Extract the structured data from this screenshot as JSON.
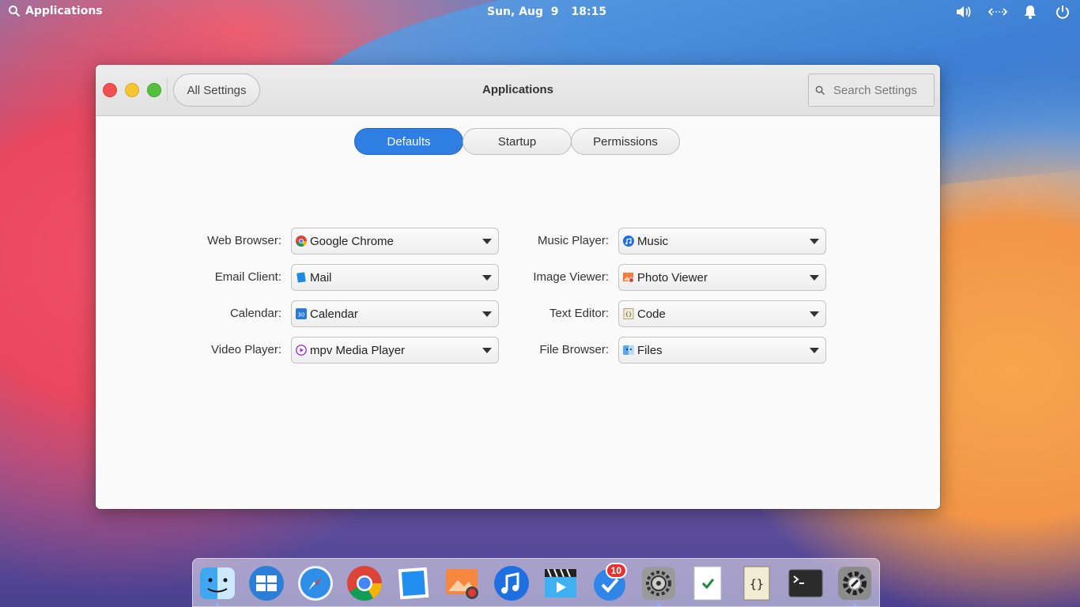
{
  "panel": {
    "applications_label": "Applications",
    "date": "Sun, Aug  9",
    "time": "18:15"
  },
  "window": {
    "title": "Applications",
    "back_button": "All Settings",
    "search_placeholder": "Search Settings"
  },
  "tabs": [
    {
      "label": "Defaults",
      "active": true
    },
    {
      "label": "Startup",
      "active": false
    },
    {
      "label": "Permissions",
      "active": false
    }
  ],
  "defaults": {
    "left": [
      {
        "label": "Web Browser:",
        "value": "Google Chrome",
        "icon": "chrome-icon"
      },
      {
        "label": "Email Client:",
        "value": "Mail",
        "icon": "mail-icon"
      },
      {
        "label": "Calendar:",
        "value": "Calendar",
        "icon": "calendar-icon"
      },
      {
        "label": "Video Player:",
        "value": "mpv Media Player",
        "icon": "mpv-icon"
      }
    ],
    "right": [
      {
        "label": "Music Player:",
        "value": "Music",
        "icon": "music-icon"
      },
      {
        "label": "Image Viewer:",
        "value": "Photo Viewer",
        "icon": "photo-icon"
      },
      {
        "label": "Text Editor:",
        "value": "Code",
        "icon": "code-icon"
      },
      {
        "label": "File Browser:",
        "value": "Files",
        "icon": "files-icon"
      }
    ]
  },
  "calendar_icon_text": "30",
  "dock": {
    "items": [
      "finder-icon",
      "multitasking-icon",
      "safari-icon",
      "chrome-icon",
      "mail-icon",
      "photos-icon",
      "music-icon",
      "videos-icon",
      "tasks-icon",
      "system-preferences-icon",
      "notes-icon",
      "code-icon",
      "terminal-icon",
      "settings-icon"
    ],
    "tasks_badge": "10",
    "running": [
      "finder-icon",
      "system-preferences-icon",
      "settings-icon"
    ]
  },
  "colors": {
    "accent": "#2f7ee3",
    "close": "#f1514e",
    "minimize": "#f7c532",
    "maximize": "#54c13d",
    "badge": "#e8302f"
  }
}
